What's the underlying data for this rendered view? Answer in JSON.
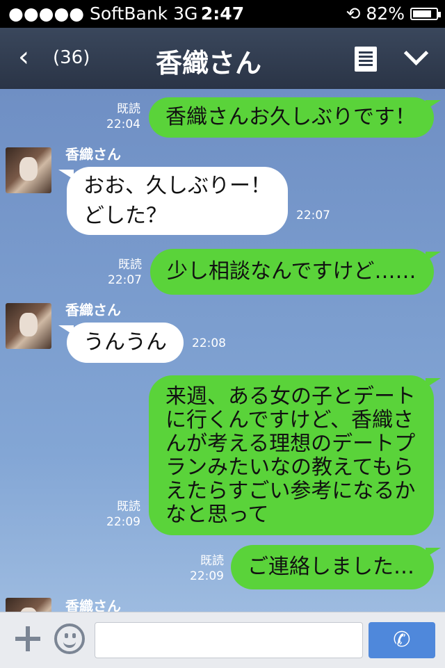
{
  "status_bar": {
    "carrier": "●●●●● SoftBank   3G",
    "time": "2:47",
    "lock_icon": "⟲",
    "battery": "82%",
    "battery_level": 0.82
  },
  "header": {
    "back_icon": "‹",
    "unread_count": "(36)",
    "title": "香織さん"
  },
  "messages": [
    {
      "from": "me",
      "text": "香織さんお久しぶりです！",
      "read": "既読",
      "time": "22:04"
    },
    {
      "from": "them",
      "sender": "香織さん",
      "lines": [
        "おお、久しぶりー！",
        "どした？"
      ],
      "time": "22:07"
    },
    {
      "from": "me",
      "text": "少し相談なんですけど……",
      "read": "既読",
      "time": "22:07"
    },
    {
      "from": "them",
      "sender": "香織さん",
      "text": "うんうん",
      "time": "22:08"
    },
    {
      "from": "me",
      "lines": [
        "来週、ある女の子とデート",
        "に行くんですけど、香織さ",
        "んが考える理想のデートプ",
        "ランみたいなの教えてもら",
        "えたらすごい参考になるか",
        "なと思って"
      ],
      "read": "既読",
      "time": "22:09"
    },
    {
      "from": "me",
      "text": "ご連絡しました…",
      "read": "既読",
      "time": "22:09"
    },
    {
      "from": "them",
      "sender": "香織さん"
    }
  ],
  "input_bar": {
    "plus_icon": "plus-icon",
    "emoji_icon": "smiley-icon",
    "placeholder": "",
    "call_icon": "✆"
  }
}
